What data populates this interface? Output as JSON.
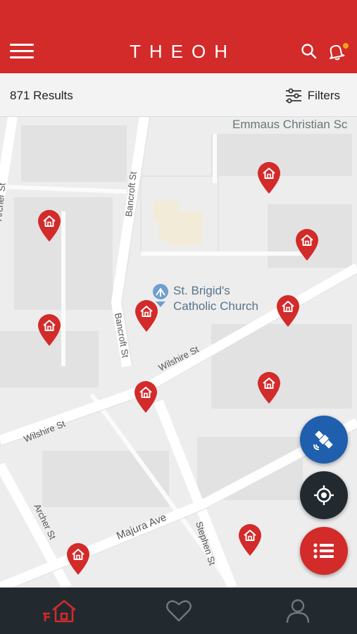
{
  "header": {
    "app_title": "THEOH",
    "menu_icon": "hamburger-menu-icon",
    "search_icon": "search-icon",
    "notification_icon": "bell-icon",
    "brand_color": "#d32a2a",
    "notification_dot_color": "#f0a21c"
  },
  "results_bar": {
    "count_label": "871 Results",
    "filters_label": "Filters",
    "filters_icon": "sliders-icon"
  },
  "map": {
    "labels": {
      "school": "Emmaus Christian Sc",
      "church_line1": "St. Brigid's",
      "church_line2": "Catholic Church",
      "bancroft_north": "Bancroft St",
      "bancroft_south": "Bancroft St",
      "archer_north": "Archer St",
      "archer_south": "Archer St",
      "wilshire_east": "Wilshire St",
      "wilshire_west": "Wilshire St",
      "majura": "Majura Ave",
      "stephen": "Stephen St"
    },
    "pin_icon": "house-pin-icon",
    "pin_color": "#d32a2a",
    "pin_count": 10
  },
  "fabs": [
    {
      "name": "satellite-view-button",
      "icon": "satellite-icon",
      "color": "#1f5fae"
    },
    {
      "name": "my-location-button",
      "icon": "crosshair-icon",
      "color": "#222a30"
    },
    {
      "name": "list-view-button",
      "icon": "list-icon",
      "color": "#d32a2a"
    }
  ],
  "bottom_nav": {
    "items": [
      {
        "name": "home",
        "icon": "house-icon",
        "active": true
      },
      {
        "name": "favorites",
        "icon": "heart-icon",
        "active": false
      },
      {
        "name": "profile",
        "icon": "person-icon",
        "active": false
      }
    ],
    "background": "#222a30",
    "active_color": "#d32a2a",
    "inactive_color": "#6f7780"
  }
}
